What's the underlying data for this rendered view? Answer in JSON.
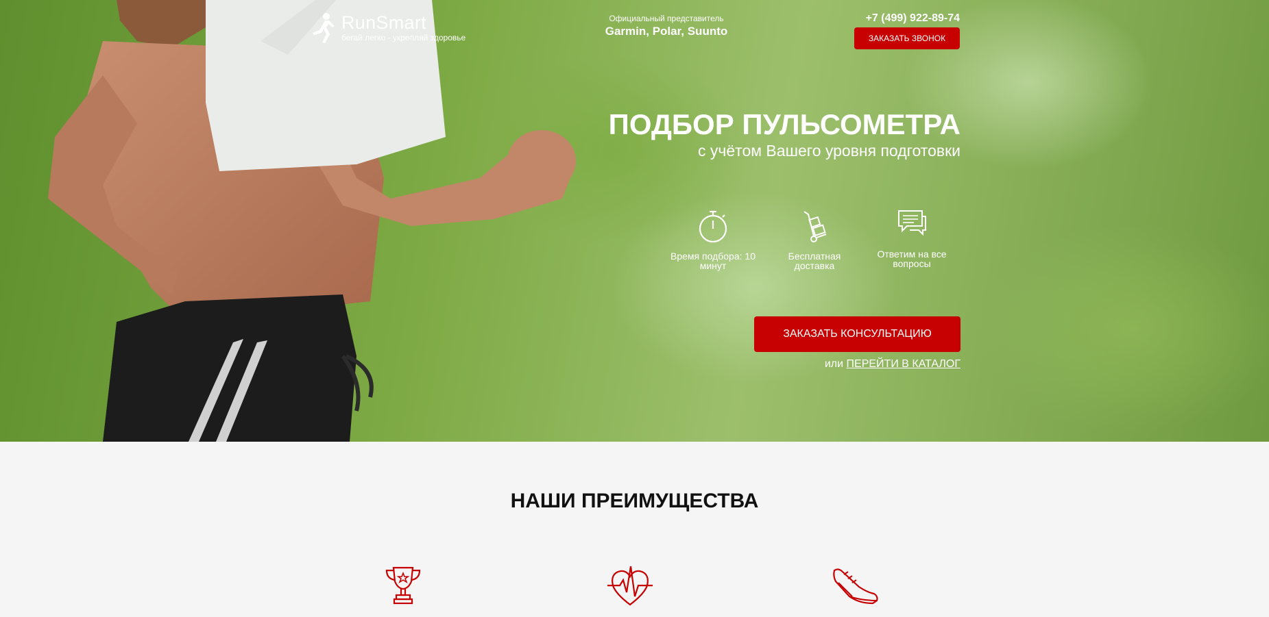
{
  "header": {
    "logo_name": "RunSmart",
    "logo_slogan": "бегай легко - укрепляй здоровье",
    "official_label": "Официальный представитель",
    "official_brands": "Garmin, Polar, Suunto",
    "phone": "+7 (499) 922-89-74",
    "call_button": "ЗАКАЗАТЬ ЗВОНОК"
  },
  "promo": {
    "title": "ПОДБОР ПУЛЬСОМЕТРА",
    "subtitle": "с учётом Вашего уровня подготовки",
    "features": [
      {
        "icon": "stopwatch-icon",
        "text": "Время подбора: 10 минут"
      },
      {
        "icon": "delivery-cart-icon",
        "text": "Бесплатная доставка"
      },
      {
        "icon": "chat-bubbles-icon",
        "text": "Ответим на все вопросы"
      }
    ],
    "consult_button": "ЗАКАЗАТЬ КОНСУЛЬТАЦИЮ",
    "catalog_prefix": "или",
    "catalog_link": "ПЕРЕЙТИ В КАТАЛОГ"
  },
  "advantages": {
    "title": "НАШИ ПРЕИМУЩЕСТВА",
    "icons": [
      "trophy-icon",
      "heart-pulse-icon",
      "sneaker-icon"
    ]
  },
  "colors": {
    "accent": "#c70101",
    "section_bg": "#f5f5f5",
    "title_dark": "#111111"
  }
}
